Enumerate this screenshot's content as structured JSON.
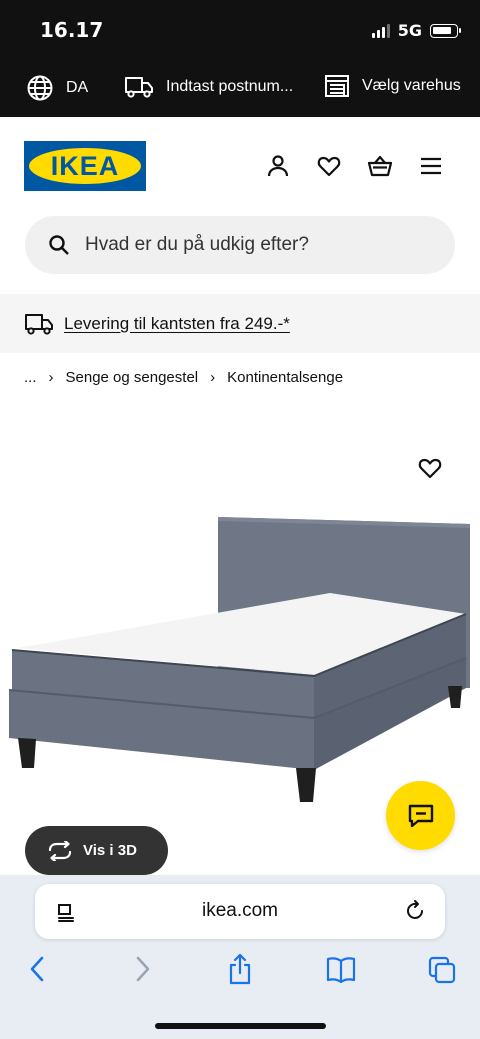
{
  "status_bar": {
    "time": "16.17",
    "network": "5G"
  },
  "utility_bar": {
    "language": "DA",
    "postcode": "Indtast postnum...",
    "store": "Vælg varehus"
  },
  "header": {
    "logo_text": "IKEA",
    "icons": [
      "user-icon",
      "heart-icon",
      "basket-icon",
      "menu-icon"
    ]
  },
  "search": {
    "placeholder": "Hvad er du på udkig efter?"
  },
  "delivery": {
    "text": "Levering til kantsten fra 249.-*"
  },
  "breadcrumb": {
    "ellipsis": "...",
    "items": [
      "Senge og sengestel",
      "Kontinentalsenge"
    ]
  },
  "product": {
    "view_3d_label": "Vis i 3D"
  },
  "browser": {
    "url": "ikea.com"
  },
  "colors": {
    "ikea_blue": "#0058a3",
    "ikea_yellow": "#ffdb00",
    "bed_fabric": "#6c7381",
    "mattress": "#f4f4f4"
  }
}
